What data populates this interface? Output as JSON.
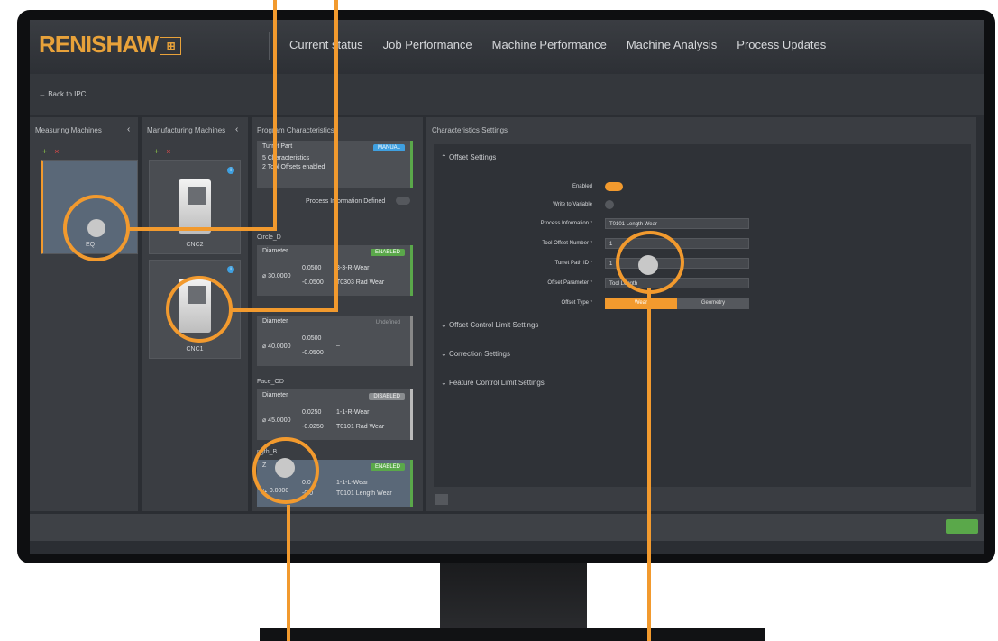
{
  "app": {
    "logo": "RENISHAW",
    "logo_mark": "⊞",
    "nav": [
      "Current status",
      "Job Performance",
      "Machine Performance",
      "Machine Analysis",
      "Process Updates"
    ],
    "back_link": "← Back to IPC"
  },
  "measuring": {
    "title": "Measuring Machines",
    "machine_label": "EQ"
  },
  "manufacturing": {
    "title": "Manufacturing Machines",
    "machines": [
      "CNC2",
      "CNC1"
    ]
  },
  "program": {
    "title": "Program Characteristics",
    "part": {
      "name": "Turret Part",
      "mode": "MANUAL",
      "line1": "5 Characteristics",
      "line2": "2 Tool Offsets enabled"
    },
    "process_info_label": "Process Information Defined",
    "groups": [
      {
        "section": "Circle_D",
        "type": "Diameter",
        "status": "ENABLED",
        "nominal": "30.0000",
        "upper": "0.0500",
        "lower": "-0.0500",
        "offset": "3-3-R-Wear",
        "tool": "T0303 Rad Wear"
      },
      {
        "section": "",
        "type": "Diameter",
        "status": "Undefined",
        "nominal": "40.0000",
        "upper": "0.0500",
        "lower": "-0.0500",
        "offset": "–",
        "tool": ""
      },
      {
        "section": "Face_OD",
        "type": "Diameter",
        "status": "DISABLED",
        "nominal": "45.0000",
        "upper": "0.0250",
        "lower": "-0.0250",
        "offset": "1-1-R-Wear",
        "tool": "T0101 Rad Wear"
      },
      {
        "section": "ngth_B",
        "type": "Z",
        "status": "ENABLED",
        "nominal": "0.0000",
        "upper": "0.0",
        "lower": "-0.0",
        "offset": "1-1-L-Wear",
        "tool": "T0101 Length Wear"
      }
    ]
  },
  "settings": {
    "title": "Characteristics Settings",
    "offset_section": "Offset Settings",
    "fields": {
      "enabled_label": "Enabled",
      "write_label": "Write to Variable",
      "process_label": "Process Information *",
      "process_value": "T0101 Length Wear",
      "tool_offset_label": "Tool Offset Number *",
      "tool_offset_value": "1",
      "turret_label": "Turret Path ID *",
      "turret_value": "1",
      "param_label": "Offset Parameter *",
      "param_value": "Tool Length",
      "type_label": "Offset Type *",
      "type_wear": "Wear",
      "type_geometry": "Geometry"
    },
    "collapsed": [
      "Offset Control Limit Settings",
      "Correction Settings",
      "Feature Control Limit Settings"
    ]
  },
  "colors": {
    "accent": "#f29a2e",
    "enabled": "#5aa84a",
    "manual": "#3fa0e0"
  }
}
